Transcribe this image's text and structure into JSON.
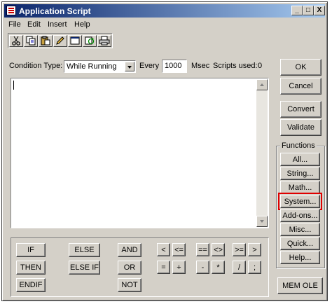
{
  "window": {
    "title": "Application Script"
  },
  "titlebar_buttons": {
    "minimize": "_",
    "maximize": "□",
    "close": "X"
  },
  "menu": [
    "File",
    "Edit",
    "Insert",
    "Help"
  ],
  "toolbar": [
    "cut-icon",
    "copy-icon",
    "paste-icon",
    "pencil-icon",
    "window-icon",
    "refresh-icon",
    "print-icon"
  ],
  "condition": {
    "label": "Condition Type:",
    "value": "While Running",
    "every_label": "Every",
    "every_value": "1000",
    "msec_label": "Msec",
    "scripts_used_label": "Scripts used:",
    "scripts_used_value": "0"
  },
  "editor": {
    "content": ""
  },
  "right_buttons": {
    "ok": "OK",
    "cancel": "Cancel",
    "convert": "Convert",
    "validate": "Validate"
  },
  "functions": {
    "label": "Functions",
    "items": [
      "All...",
      "String...",
      "Math...",
      "System...",
      "Add-ons...",
      "Misc...",
      "Quick...",
      "Help..."
    ],
    "highlighted": "System..."
  },
  "mem_ole": "MEM OLE",
  "keywords": {
    "if": "IF",
    "then": "THEN",
    "endif": "ENDIF",
    "else": "ELSE",
    "elseif": "ELSE IF",
    "and": "AND",
    "or": "OR",
    "not": "NOT"
  },
  "operators": [
    "<",
    "<=",
    "==",
    "<>",
    ">=",
    ">",
    "=",
    "+",
    "-",
    "*",
    "/",
    ";"
  ],
  "colors": {
    "title_start": "#0a246a",
    "title_end": "#a6caf0",
    "highlight": "#e00000",
    "face": "#d4d0c8"
  }
}
